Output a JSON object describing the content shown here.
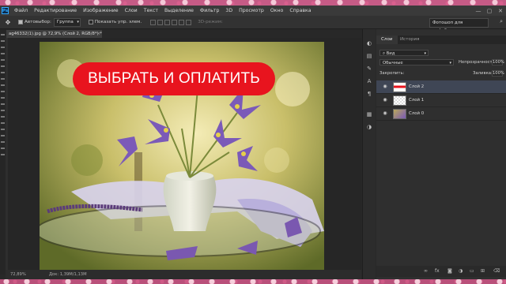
{
  "menu": {
    "logo": "Ps",
    "items": [
      "Файл",
      "Редактирование",
      "Изображение",
      "Слои",
      "Текст",
      "Выделение",
      "Фильтр",
      "3D",
      "Просмотр",
      "Окно",
      "Справка"
    ],
    "window_controls": [
      "—",
      "▢",
      "✕"
    ]
  },
  "options": {
    "tool_icon": "move-icon",
    "autoselect_label": "Автовыбор:",
    "autoselect_value": "Группа",
    "show_controls_label": "Показать упр. элем.",
    "mode3d_label": "3D-режим:",
    "workspace": "Фотошоп для инфобизнеса"
  },
  "document": {
    "tab_title": "ag46332(1).jpg @ 72,9% (Слой 2, RGB/8*) *",
    "zoom": "72,89%",
    "doc_size": "Док: 1,39M/1,13M"
  },
  "canvas": {
    "cta_text": "ВЫБРАТЬ И ОПЛАТИТЬ",
    "cta_color": "#e8141e"
  },
  "layers_panel": {
    "tabs": [
      "Слои",
      "История"
    ],
    "active_tab": "Слои",
    "filter_label": "Вид",
    "blend_mode": "Обычные",
    "opacity_label": "Непрозрачность:",
    "opacity_value": "100%",
    "lock_label": "Закрепить:",
    "fill_label": "Заливка:",
    "fill_value": "100%",
    "layers": [
      {
        "name": "Слой 2",
        "active": true
      },
      {
        "name": "Слой 1",
        "active": false
      },
      {
        "name": "Слой 0",
        "active": false
      }
    ],
    "footer_icons": [
      "link-icon",
      "fx-icon",
      "mask-icon",
      "adjustment-icon",
      "folder-icon",
      "new-layer-icon",
      "trash-icon"
    ]
  }
}
